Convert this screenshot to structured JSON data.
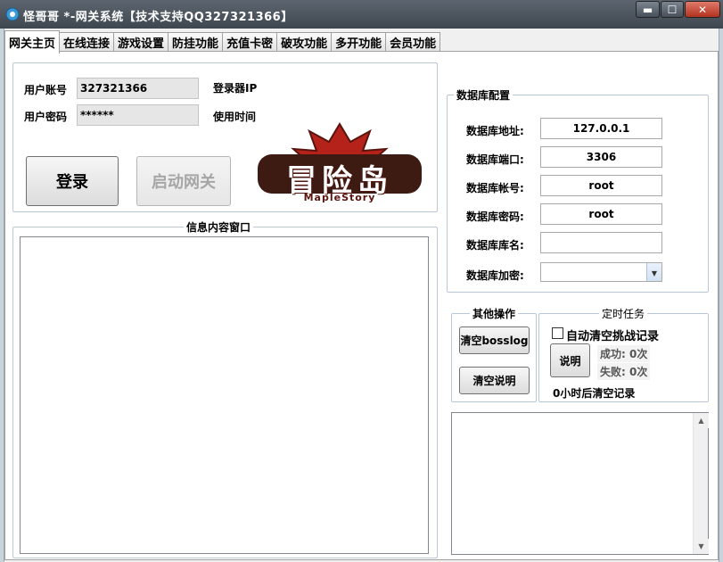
{
  "window": {
    "title": "怪哥哥 *-网关系统【技术支持QQ327321366】",
    "min_label": "▬",
    "max_label": "☐",
    "close_label": "✕"
  },
  "tabs": [
    {
      "label": "网关主页"
    },
    {
      "label": "在线连接"
    },
    {
      "label": "游戏设置"
    },
    {
      "label": "防挂功能"
    },
    {
      "label": "充值卡密"
    },
    {
      "label": "破攻功能"
    },
    {
      "label": "多开功能"
    },
    {
      "label": "会员功能"
    }
  ],
  "login": {
    "account_label": "用户账号",
    "account_value": "327321366",
    "password_label": "用户密码",
    "password_value": "******",
    "ip_label": "登录器IP",
    "time_label": "使用时间",
    "login_button": "登录",
    "start_button": "启动网关"
  },
  "logo": {
    "title": "冒险岛",
    "subtitle": "MapleStory"
  },
  "info_window": {
    "title": "信息内容窗口"
  },
  "db": {
    "title": "数据库配置",
    "fields": [
      {
        "label": "数据库地址:",
        "value": "127.0.0.1"
      },
      {
        "label": "数据库端口:",
        "value": "3306"
      },
      {
        "label": "数据库帐号:",
        "value": "root"
      },
      {
        "label": "数据库密码:",
        "value": "root"
      },
      {
        "label": "数据库库名:",
        "value": ""
      }
    ],
    "encrypt_label": "数据库加密:",
    "encrypt_value": ""
  },
  "other_ops": {
    "title": "其他操作",
    "clear_bosslog": "清空bosslog",
    "clear_help": "清空说明"
  },
  "timer": {
    "title": "定时任务",
    "auto_clear_label": "自动清空挑战记录",
    "auto_clear_checked": false,
    "help_button": "说明",
    "success": "成功: 0次",
    "fail": "失败: 0次",
    "footer": "0小时后清空记录"
  },
  "colors": {
    "titlebar": "#4a525b",
    "close": "#c0392b",
    "group_border": "#b8c8d8",
    "logo_red": "#b5221a",
    "logo_dark": "#4a1f14"
  },
  "icons": {
    "app": "app-icon",
    "dropdown": "chevron-down-icon",
    "scroll_up": "scroll-up-icon",
    "scroll_down": "scroll-down-icon"
  }
}
